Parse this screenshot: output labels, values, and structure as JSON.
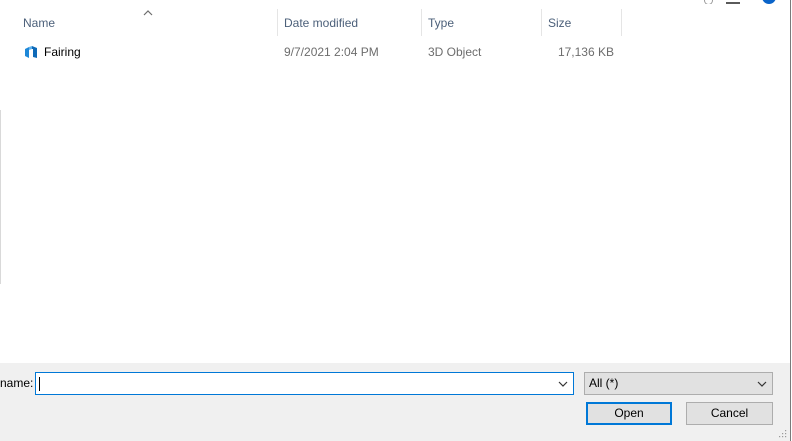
{
  "columns": {
    "name": "Name",
    "date_modified": "Date modified",
    "type": "Type",
    "size": "Size",
    "sorted_by": "Name"
  },
  "files": [
    {
      "name": "Fairing",
      "date_modified": "9/7/2021 2:04 PM",
      "type": "3D Object",
      "size": "17,136 KB",
      "icon": "3d-object-file-icon"
    }
  ],
  "footer": {
    "file_name_label": "name:",
    "file_name_value": "",
    "filter_value": "All (*)",
    "open_label": "Open",
    "cancel_label": "Cancel"
  },
  "colors": {
    "header_text": "#4c607a",
    "accent": "#0078d7",
    "panel": "#f0f0f0",
    "icon_blue": "#1e88d8"
  }
}
